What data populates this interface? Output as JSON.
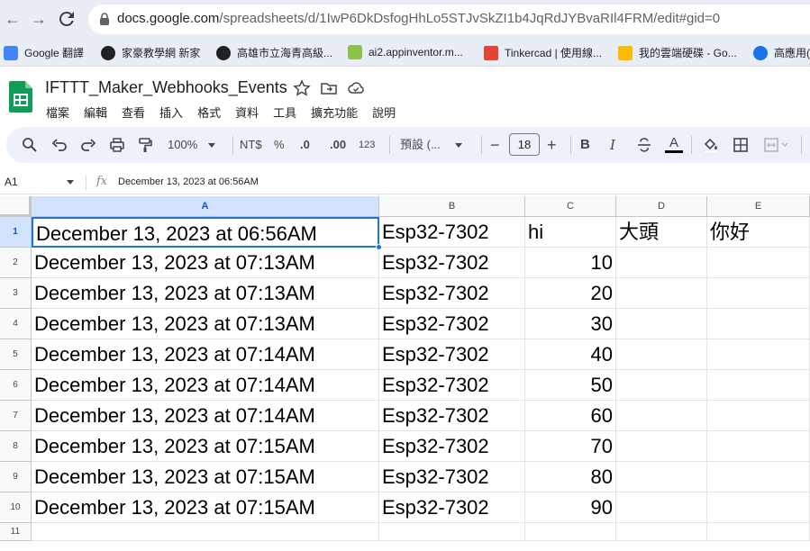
{
  "browser": {
    "url_host": "docs.google.com",
    "url_path": "/spreadsheets/d/1IwP6DkDsfogHhLo5STJvSkZI1b4JqRdJYBvaRIl4FRM/edit#gid=0"
  },
  "bookmarks": [
    {
      "label": "Google 翻譯",
      "color": "#4285f4"
    },
    {
      "label": "家豪教學網 新家",
      "color": "#202124"
    },
    {
      "label": "高雄市立海青高級...",
      "color": "#202124"
    },
    {
      "label": "ai2.appinventor.m...",
      "color": "#8bc34a"
    },
    {
      "label": "Tinkercad | 使用線...",
      "color": "#e94235"
    },
    {
      "label": "我的雲端硬碟 - Go...",
      "color": "#fbbc04"
    },
    {
      "label": "高應用(",
      "color": "#1a73e8"
    }
  ],
  "doc": {
    "title": "IFTTT_Maker_Webhooks_Events"
  },
  "menu": [
    "檔案",
    "編輯",
    "查看",
    "插入",
    "格式",
    "資料",
    "工具",
    "擴充功能",
    "說明"
  ],
  "toolbar": {
    "zoom": "100%",
    "currency": "NT$",
    "percent": "%",
    "dec_decrease": ".0",
    "dec_increase": ".00",
    "more_formats": "123",
    "font": "預設 (...",
    "font_size": "18",
    "bold": "B",
    "italic": "I",
    "text_color": "A"
  },
  "formula_bar": {
    "cell_ref": "A1",
    "fx": "fx",
    "value": "December 13, 2023 at 06:56AM"
  },
  "grid": {
    "columns": [
      "A",
      "B",
      "C",
      "D",
      "E"
    ],
    "row_numbers": [
      "1",
      "2",
      "3",
      "4",
      "5",
      "6",
      "7",
      "8",
      "9",
      "10",
      "11"
    ],
    "rows": [
      {
        "a": "December 13, 2023 at 06:56AM",
        "b": "Esp32-7302",
        "c": "hi",
        "d": "大頭",
        "e": "你好"
      },
      {
        "a": "December 13, 2023 at 07:13AM",
        "b": "Esp32-7302",
        "c": "10",
        "d": "",
        "e": ""
      },
      {
        "a": "December 13, 2023 at 07:13AM",
        "b": "Esp32-7302",
        "c": "20",
        "d": "",
        "e": ""
      },
      {
        "a": "December 13, 2023 at 07:13AM",
        "b": "Esp32-7302",
        "c": "30",
        "d": "",
        "e": ""
      },
      {
        "a": "December 13, 2023 at 07:14AM",
        "b": "Esp32-7302",
        "c": "40",
        "d": "",
        "e": ""
      },
      {
        "a": "December 13, 2023 at 07:14AM",
        "b": "Esp32-7302",
        "c": "50",
        "d": "",
        "e": ""
      },
      {
        "a": "December 13, 2023 at 07:14AM",
        "b": "Esp32-7302",
        "c": "60",
        "d": "",
        "e": ""
      },
      {
        "a": "December 13, 2023 at 07:15AM",
        "b": "Esp32-7302",
        "c": "70",
        "d": "",
        "e": ""
      },
      {
        "a": "December 13, 2023 at 07:15AM",
        "b": "Esp32-7302",
        "c": "80",
        "d": "",
        "e": ""
      },
      {
        "a": "December 13, 2023 at 07:15AM",
        "b": "Esp32-7302",
        "c": "90",
        "d": "",
        "e": ""
      }
    ]
  }
}
